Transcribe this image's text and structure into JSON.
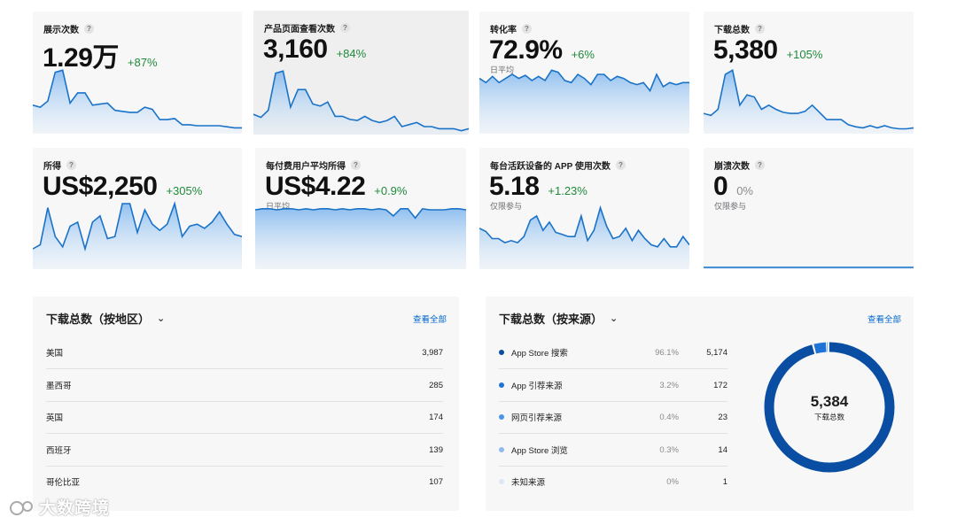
{
  "metrics": [
    {
      "title": "展示次数",
      "value": "1.29万",
      "change": "+87%",
      "note": "",
      "spark": [
        26,
        24,
        30,
        58,
        60,
        28,
        38,
        38,
        26,
        27,
        28,
        21,
        20,
        19,
        19,
        24,
        22,
        12,
        12,
        13,
        7,
        7,
        6,
        6,
        6,
        6,
        5,
        4,
        4
      ]
    },
    {
      "title": "产品页面查看次数",
      "value": "3,160",
      "change": "+84%",
      "note": "",
      "spark": [
        18,
        15,
        22,
        58,
        60,
        25,
        42,
        42,
        28,
        26,
        30,
        16,
        16,
        13,
        12,
        16,
        12,
        10,
        12,
        16,
        6,
        8,
        10,
        6,
        6,
        4,
        4,
        4,
        2,
        4
      ]
    },
    {
      "title": "转化率",
      "value": "72.9%",
      "change": "+6%",
      "note": "日平均",
      "spark": [
        52,
        48,
        54,
        48,
        52,
        56,
        52,
        55,
        50,
        54,
        50,
        60,
        58,
        50,
        48,
        56,
        52,
        46,
        56,
        56,
        50,
        54,
        52,
        48,
        46,
        48,
        40,
        56,
        44,
        48,
        46,
        48,
        48
      ]
    },
    {
      "title": "下载总数",
      "value": "5,380",
      "change": "+105%",
      "note": "",
      "spark": [
        18,
        16,
        22,
        56,
        60,
        26,
        36,
        34,
        22,
        26,
        22,
        19,
        18,
        18,
        20,
        26,
        19,
        12,
        12,
        12,
        7,
        5,
        4,
        6,
        4,
        6,
        4,
        3,
        3,
        4
      ]
    },
    {
      "title": "所得",
      "value": "US$2,250",
      "change": "+305%",
      "note": "",
      "spark": [
        18,
        22,
        58,
        30,
        20,
        40,
        44,
        18,
        44,
        50,
        28,
        30,
        62,
        62,
        34,
        56,
        42,
        36,
        42,
        62,
        30,
        40,
        42,
        38,
        44,
        54,
        42,
        32,
        30
      ]
    },
    {
      "title": "每付费用户平均所得",
      "value": "US$4.22",
      "change": "+0.9%",
      "note": "日平均",
      "spark": [
        56,
        57,
        57,
        56,
        57,
        57,
        56,
        57,
        56,
        57,
        57,
        56,
        57,
        56,
        57,
        57,
        56,
        57,
        56,
        50,
        57,
        57,
        48,
        57,
        56,
        56,
        56,
        57,
        57,
        56
      ]
    },
    {
      "title": "每台活跃设备的 APP 使用次数",
      "value": "5.18",
      "change": "+1.23%",
      "note": "仅限参与",
      "spark": [
        38,
        35,
        28,
        28,
        24,
        26,
        24,
        30,
        46,
        50,
        36,
        44,
        34,
        32,
        30,
        30,
        50,
        26,
        36,
        58,
        40,
        28,
        30,
        38,
        26,
        36,
        28,
        22,
        20,
        28,
        20,
        20,
        30,
        22
      ]
    },
    {
      "title": "崩溃次数",
      "value": "0",
      "change": "0%",
      "note": "仅限参与",
      "spark": [
        0,
        0,
        0,
        0,
        0,
        0,
        0,
        0,
        0,
        0,
        0,
        0,
        0,
        0,
        0,
        0,
        0,
        0,
        0,
        0,
        0,
        0,
        0,
        0,
        0,
        0,
        0,
        0,
        0,
        0
      ]
    }
  ],
  "by_region": {
    "title": "下载总数（按地区）",
    "view_all": "查看全部",
    "rows": [
      {
        "name": "美国",
        "value": "3,987"
      },
      {
        "name": "墨西哥",
        "value": "285"
      },
      {
        "name": "英国",
        "value": "174"
      },
      {
        "name": "西班牙",
        "value": "139"
      },
      {
        "name": "哥伦比亚",
        "value": "107"
      }
    ]
  },
  "by_source": {
    "title": "下载总数（按来源）",
    "view_all": "查看全部",
    "total": "5,384",
    "total_label": "下载总数",
    "rows": [
      {
        "name": "App Store 搜索",
        "pct": "96.1%",
        "value": "5,174",
        "color": "#0a4ea3",
        "share": 96.1
      },
      {
        "name": "App 引荐来源",
        "pct": "3.2%",
        "value": "172",
        "color": "#1f73d6",
        "share": 3.2
      },
      {
        "name": "网页引荐来源",
        "pct": "0.4%",
        "value": "23",
        "color": "#4a94e8",
        "share": 0.4
      },
      {
        "name": "App Store 浏览",
        "pct": "0.3%",
        "value": "14",
        "color": "#8fbaf0",
        "share": 0.3
      },
      {
        "name": "未知来源",
        "pct": "0%",
        "value": "1",
        "color": "#dde8f6",
        "share": 0
      }
    ]
  },
  "colors": {
    "line": "#1a73c8",
    "positive": "#1f8a3b",
    "link": "#0066cc"
  },
  "watermark": "大数跨境"
}
